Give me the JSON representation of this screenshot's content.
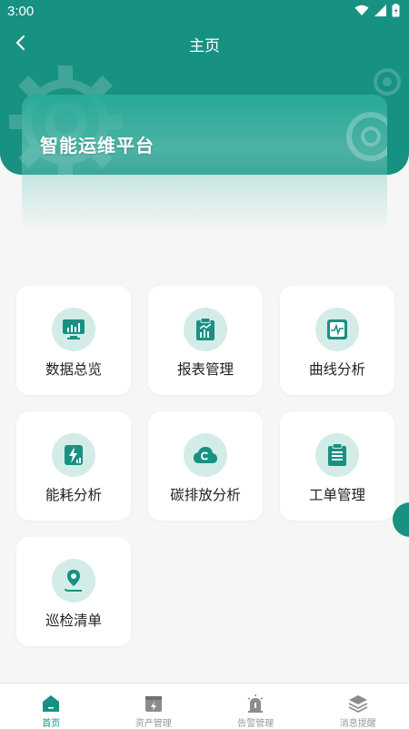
{
  "status_bar": {
    "time": "3:00"
  },
  "nav": {
    "title": "主页"
  },
  "banner": {
    "title": "智能运维平台"
  },
  "tiles": [
    {
      "label": "数据总览",
      "icon": "monitor-chart-icon"
    },
    {
      "label": "报表管理",
      "icon": "clipboard-chart-icon"
    },
    {
      "label": "曲线分析",
      "icon": "waveform-icon"
    },
    {
      "label": "能耗分析",
      "icon": "energy-icon"
    },
    {
      "label": "碳排放分析",
      "icon": "carbon-cloud-icon"
    },
    {
      "label": "工单管理",
      "icon": "work-order-icon"
    },
    {
      "label": "巡检清单",
      "icon": "location-pin-icon"
    }
  ],
  "tabbar": [
    {
      "label": "首页",
      "icon": "home-icon",
      "active": true
    },
    {
      "label": "资产管理",
      "icon": "asset-icon",
      "active": false
    },
    {
      "label": "告警管理",
      "icon": "alarm-icon",
      "active": false
    },
    {
      "label": "消息提醒",
      "icon": "layers-icon",
      "active": false
    }
  ],
  "colors": {
    "primary": "#179182",
    "icon_bg": "#d4ece7",
    "page_bg": "#f6f6f6"
  }
}
